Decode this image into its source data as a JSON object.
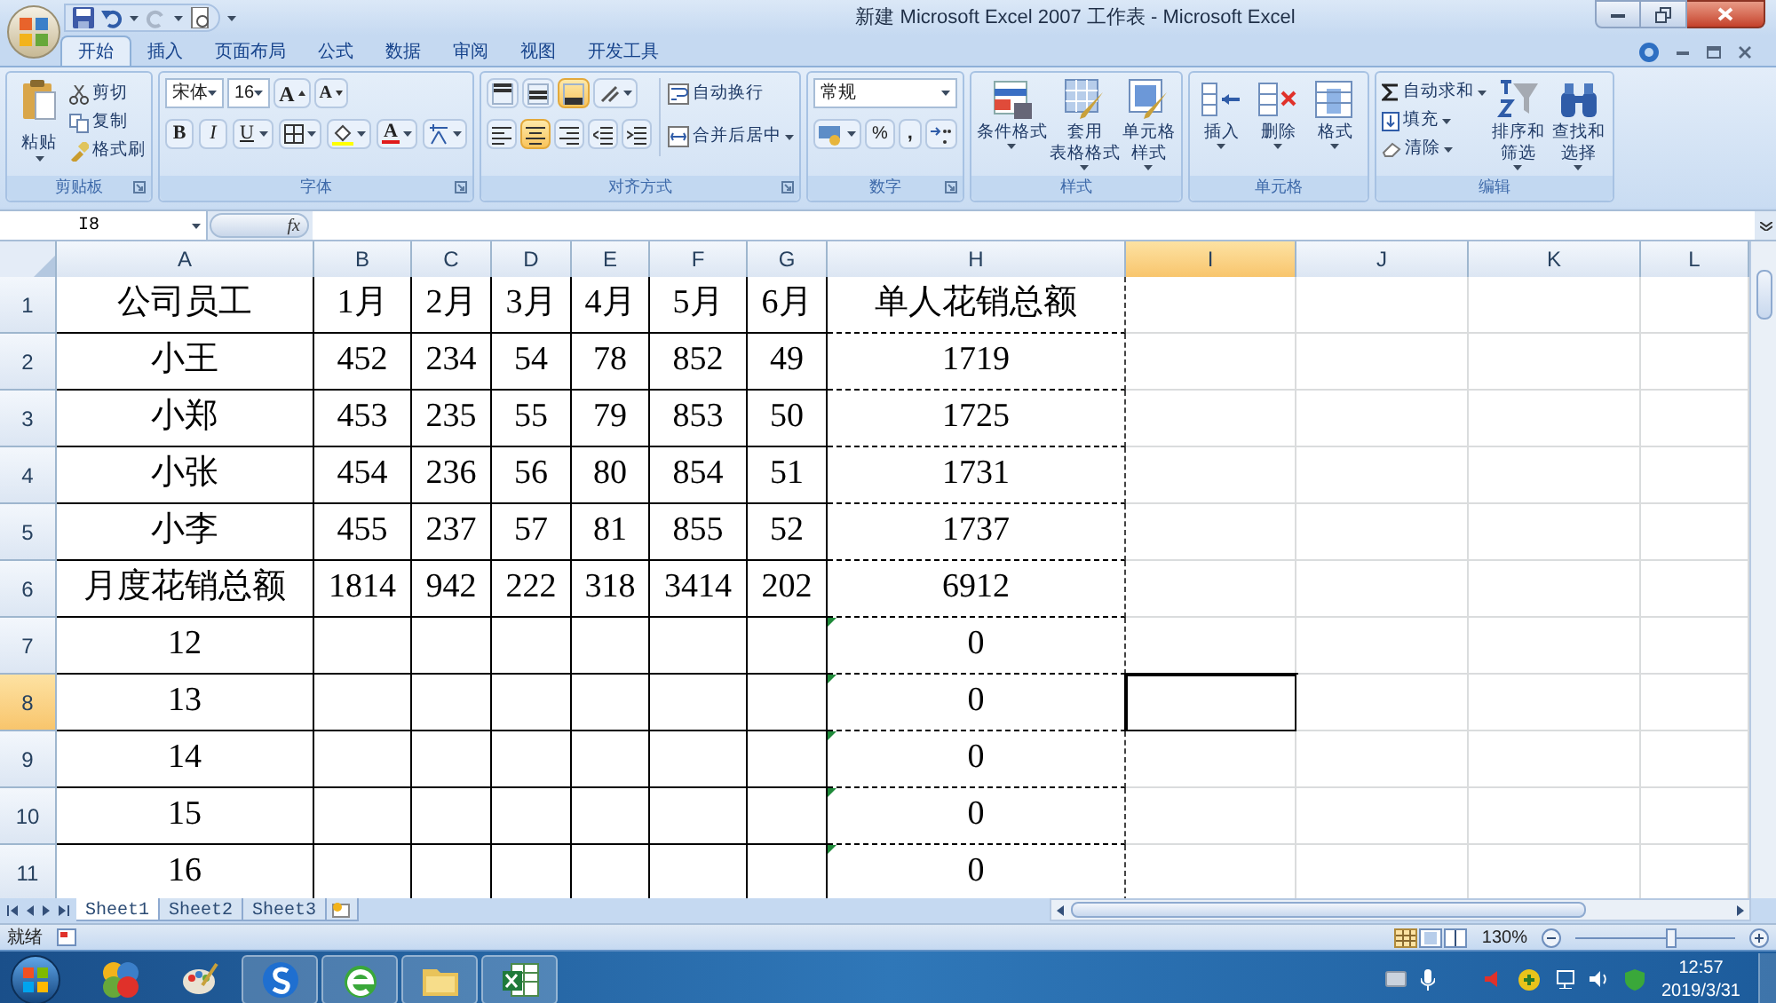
{
  "window": {
    "title": "新建 Microsoft Excel 2007 工作表 - Microsoft Excel"
  },
  "tabs": [
    {
      "label": "开始",
      "selected": true
    },
    {
      "label": "插入",
      "selected": false
    },
    {
      "label": "页面布局",
      "selected": false
    },
    {
      "label": "公式",
      "selected": false
    },
    {
      "label": "数据",
      "selected": false
    },
    {
      "label": "审阅",
      "selected": false
    },
    {
      "label": "视图",
      "selected": false
    },
    {
      "label": "开发工具",
      "selected": false
    }
  ],
  "ribbon": [
    {
      "label": "剪贴板",
      "items": [
        "粘贴",
        "剪切",
        "复制",
        "格式刷"
      ]
    },
    {
      "label": "字体",
      "font": "宋体",
      "size": "16",
      "grow": "A",
      "shrink": "A",
      "bold": "B",
      "italic": "I",
      "underline": "U",
      "font_color_letter": "A"
    },
    {
      "label": "对齐方式",
      "vertical": [
        {
          "selected": false
        },
        {
          "selected": false
        },
        {
          "selected": true
        }
      ],
      "horizontal": [
        {
          "selected": false
        },
        {
          "selected": true
        },
        {
          "selected": false
        }
      ],
      "wrap": "自动换行",
      "merge": "合并后居中"
    },
    {
      "label": "数字",
      "format": "常规",
      "percent": "%",
      "comma": ","
    },
    {
      "label": "样式",
      "items": [
        [
          "条件格式"
        ],
        [
          "套用",
          "表格格式"
        ],
        [
          "单元格",
          "样式"
        ]
      ]
    },
    {
      "label": "单元格",
      "items": [
        [
          "插入"
        ],
        [
          "删除"
        ],
        [
          "格式"
        ]
      ]
    },
    {
      "label": "编辑",
      "small": [
        "自动求和",
        "填充",
        "清除"
      ],
      "items": [
        [
          "排序和",
          "筛选"
        ],
        [
          "查找和",
          "选择"
        ]
      ]
    }
  ],
  "name_box": "I8",
  "function_button": "fx",
  "columns": [
    {
      "label": "A",
      "selected": false
    },
    {
      "label": "B",
      "selected": false
    },
    {
      "label": "C",
      "selected": false
    },
    {
      "label": "D",
      "selected": false
    },
    {
      "label": "E",
      "selected": false
    },
    {
      "label": "F",
      "selected": false
    },
    {
      "label": "G",
      "selected": false
    },
    {
      "label": "H",
      "selected": false
    },
    {
      "label": "I",
      "selected": true
    },
    {
      "label": "J",
      "selected": false
    },
    {
      "label": "K",
      "selected": false
    },
    {
      "label": "L",
      "selected": false
    }
  ],
  "rows": [
    {
      "header": "1",
      "selected": false,
      "error_indicator": false,
      "cells": {
        "A": "公司员工",
        "B": "1月",
        "C": "2月",
        "D": "3月",
        "E": "4月",
        "F": "5月",
        "G": "6月",
        "H": "单人花销总额"
      }
    },
    {
      "header": "2",
      "selected": false,
      "error_indicator": false,
      "cells": {
        "A": "小王",
        "B": "452",
        "C": "234",
        "D": "54",
        "E": "78",
        "F": "852",
        "G": "49",
        "H": "1719"
      }
    },
    {
      "header": "3",
      "selected": false,
      "error_indicator": false,
      "cells": {
        "A": "小郑",
        "B": "453",
        "C": "235",
        "D": "55",
        "E": "79",
        "F": "853",
        "G": "50",
        "H": "1725"
      }
    },
    {
      "header": "4",
      "selected": false,
      "error_indicator": false,
      "cells": {
        "A": "小张",
        "B": "454",
        "C": "236",
        "D": "56",
        "E": "80",
        "F": "854",
        "G": "51",
        "H": "1731"
      }
    },
    {
      "header": "5",
      "selected": false,
      "error_indicator": false,
      "cells": {
        "A": "小李",
        "B": "455",
        "C": "237",
        "D": "57",
        "E": "81",
        "F": "855",
        "G": "52",
        "H": "1737"
      }
    },
    {
      "header": "6",
      "selected": false,
      "error_indicator": false,
      "cells": {
        "A": "月度花销总额",
        "B": "1814",
        "C": "942",
        "D": "222",
        "E": "318",
        "F": "3414",
        "G": "202",
        "H": "6912"
      }
    },
    {
      "header": "7",
      "selected": false,
      "error_indicator": true,
      "cells": {
        "A": "12",
        "H": "0"
      }
    },
    {
      "header": "8",
      "selected": true,
      "error_indicator": true,
      "cells": {
        "A": "13",
        "H": "0"
      }
    },
    {
      "header": "9",
      "selected": false,
      "error_indicator": true,
      "cells": {
        "A": "14",
        "H": "0"
      }
    },
    {
      "header": "10",
      "selected": false,
      "error_indicator": true,
      "cells": {
        "A": "15",
        "H": "0"
      }
    },
    {
      "header": "11",
      "selected": false,
      "error_indicator": true,
      "cells": {
        "A": "16",
        "H": "0"
      }
    }
  ],
  "sheets": [
    {
      "label": "Sheet1",
      "selected": true
    },
    {
      "label": "Sheet2",
      "selected": false
    },
    {
      "label": "Sheet3",
      "selected": false
    }
  ],
  "status": {
    "text": "就绪",
    "zoom": "130%",
    "level": 0.6
  },
  "taskbar": {
    "apps": [
      {
        "running": false
      },
      {
        "running": false
      },
      {
        "running": true
      },
      {
        "running": true
      },
      {
        "running": true
      },
      {
        "running": true
      }
    ],
    "time": "12:57",
    "date": "2019/3/31"
  }
}
